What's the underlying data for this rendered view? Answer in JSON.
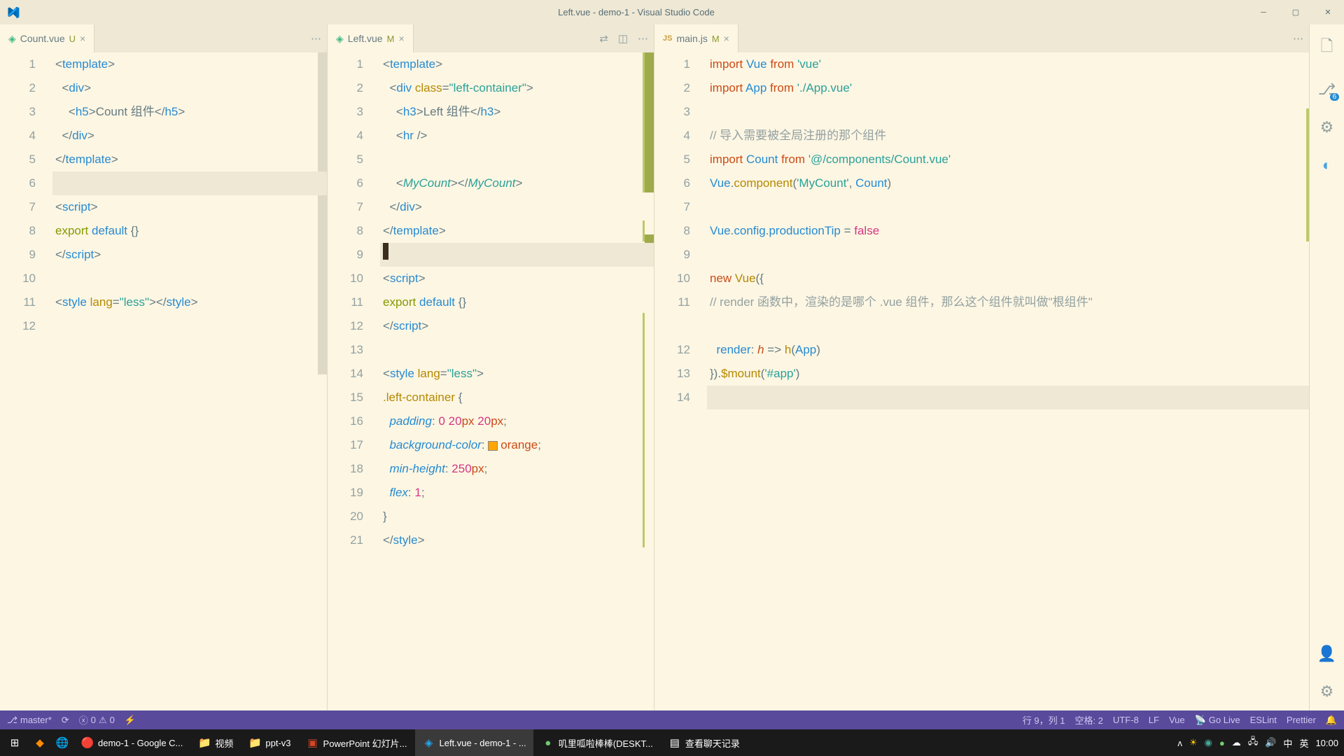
{
  "titlebar": {
    "title": "Left.vue - demo-1 - Visual Studio Code"
  },
  "tabs": {
    "g1": {
      "icon": "◈",
      "name": "Count.vue",
      "status": "U"
    },
    "g2": {
      "icon": "◈",
      "name": "Left.vue",
      "status": "M"
    },
    "g3": {
      "icon": "JS",
      "name": "main.js",
      "status": "M"
    }
  },
  "statusbar": {
    "branch": "master*",
    "errors": "0",
    "warnings": "0",
    "line_col": "行 9，列 1",
    "spaces": "空格: 2",
    "encoding": "UTF-8",
    "eol": "LF",
    "lang": "Vue",
    "golive": "Go Live",
    "eslint": "ESLint",
    "prettier": "Prettier"
  },
  "activity": {
    "badge": "6"
  },
  "taskbar": {
    "items": [
      {
        "label": "demo-1 - Google C...",
        "icon": "chrome"
      },
      {
        "label": "视频",
        "icon": "folder"
      },
      {
        "label": "ppt-v3",
        "icon": "folder"
      },
      {
        "label": "PowerPoint 幻灯片...",
        "icon": "ppt"
      },
      {
        "label": "Left.vue - demo-1 - ...",
        "icon": "vscode",
        "active": true
      },
      {
        "label": "叽里呱啦棒棒(DESKT...",
        "icon": "app"
      },
      {
        "label": "查看聊天记录",
        "icon": "app2"
      }
    ],
    "time": "10:00",
    "ime1": "中",
    "ime2": "英"
  },
  "code": {
    "count_h5": "Count 组件",
    "left_h3": "Left 组件",
    "comment1": "// 导入需要被全局注册的那个组件",
    "comment2": "// render 函数中，渲染的是哪个 .vue 组件，那么这个组件就叫做\"根组件\""
  }
}
